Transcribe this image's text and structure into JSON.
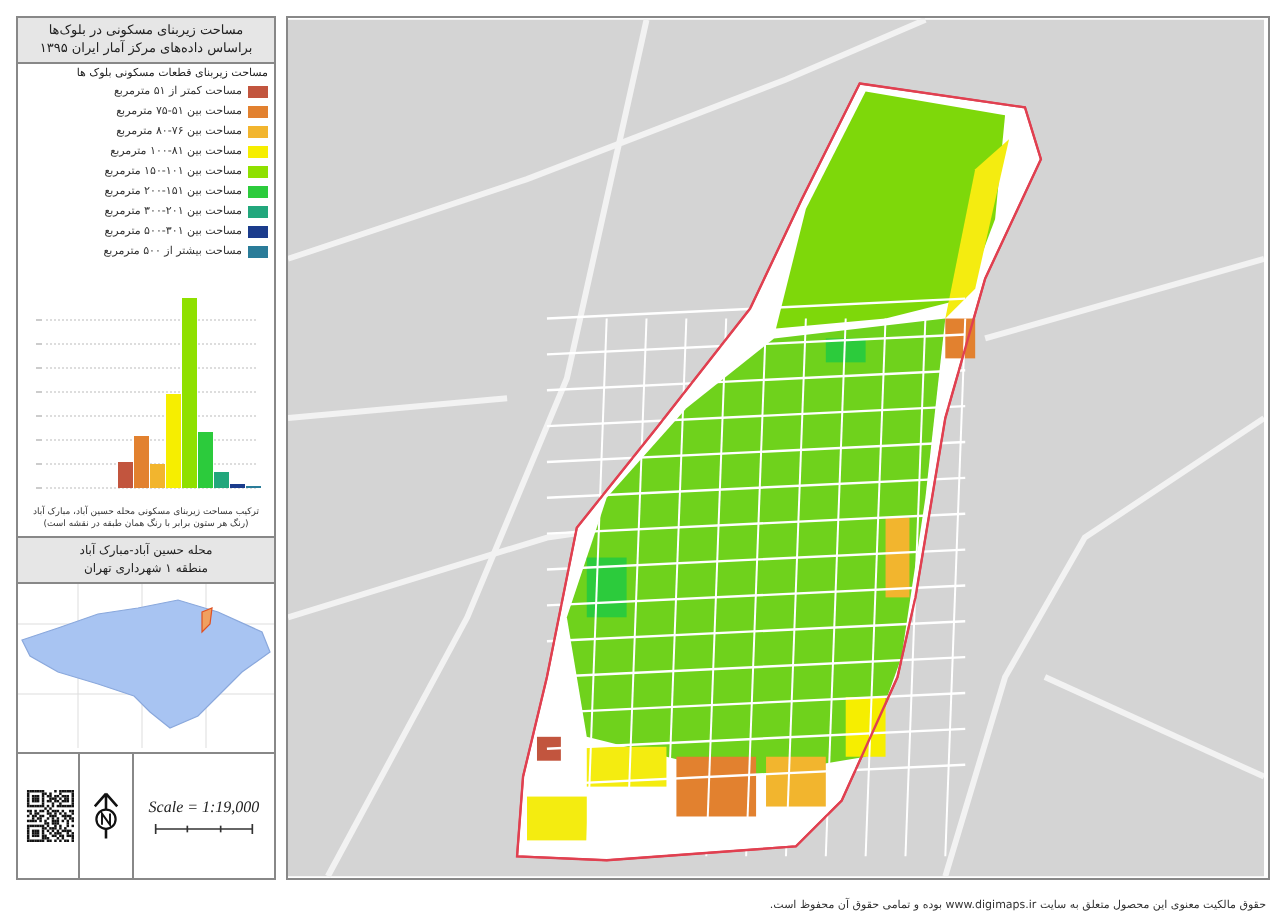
{
  "title_box": {
    "lines": [
      "مساحت زیربنای مسکونی در بلوک‌ها",
      "براساس داده‌های مرکز آمار ایران ۱۳۹۵"
    ]
  },
  "legend": {
    "heading": "مساحت زیربنای قطعات مسکونی بلوک ها",
    "items": [
      {
        "label": "مساحت کمتر از ۵۱ مترمربع",
        "color": "#c2553e"
      },
      {
        "label": "مساحت بین ۵۱-۷۵ مترمربع",
        "color": "#e2812f"
      },
      {
        "label": "مساحت بین ۷۶-۸۰ مترمربع",
        "color": "#f2b52e"
      },
      {
        "label": "مساحت بین ۸۱-۱۰۰ مترمربع",
        "color": "#f6ee00"
      },
      {
        "label": "مساحت بین ۱۰۱-۱۵۰ مترمربع",
        "color": "#8fe000"
      },
      {
        "label": "مساحت بین ۱۵۱-۲۰۰ مترمربع",
        "color": "#2ccb3c"
      },
      {
        "label": "مساحت بین ۲۰۱-۳۰۰ مترمربع",
        "color": "#22a77c"
      },
      {
        "label": "مساحت بین ۳۰۱-۵۰۰ مترمربع",
        "color": "#1b3c8c"
      },
      {
        "label": "مساحت بیشتر از ۵۰۰ مترمربع",
        "color": "#2a7c99"
      }
    ]
  },
  "chart_caption": [
    "ترکیب مساحت زیربنای مسکونی محله حسین آباد، مبارک آباد",
    "(رنگ هر ستون برابر با رنگ همان طبقه در نقشه است)"
  ],
  "location": {
    "lines": [
      "محله حسین آباد-مبارک آباد",
      "منطقه ۱ شهرداری تهران"
    ]
  },
  "scale": {
    "text": "Scale = 1:19,000"
  },
  "footer": "حقوق مالکیت معنوی این محصول متعلق به سایت www.digimaps.ir بوده و تمامی حقوق آن محفوظ است."
}
